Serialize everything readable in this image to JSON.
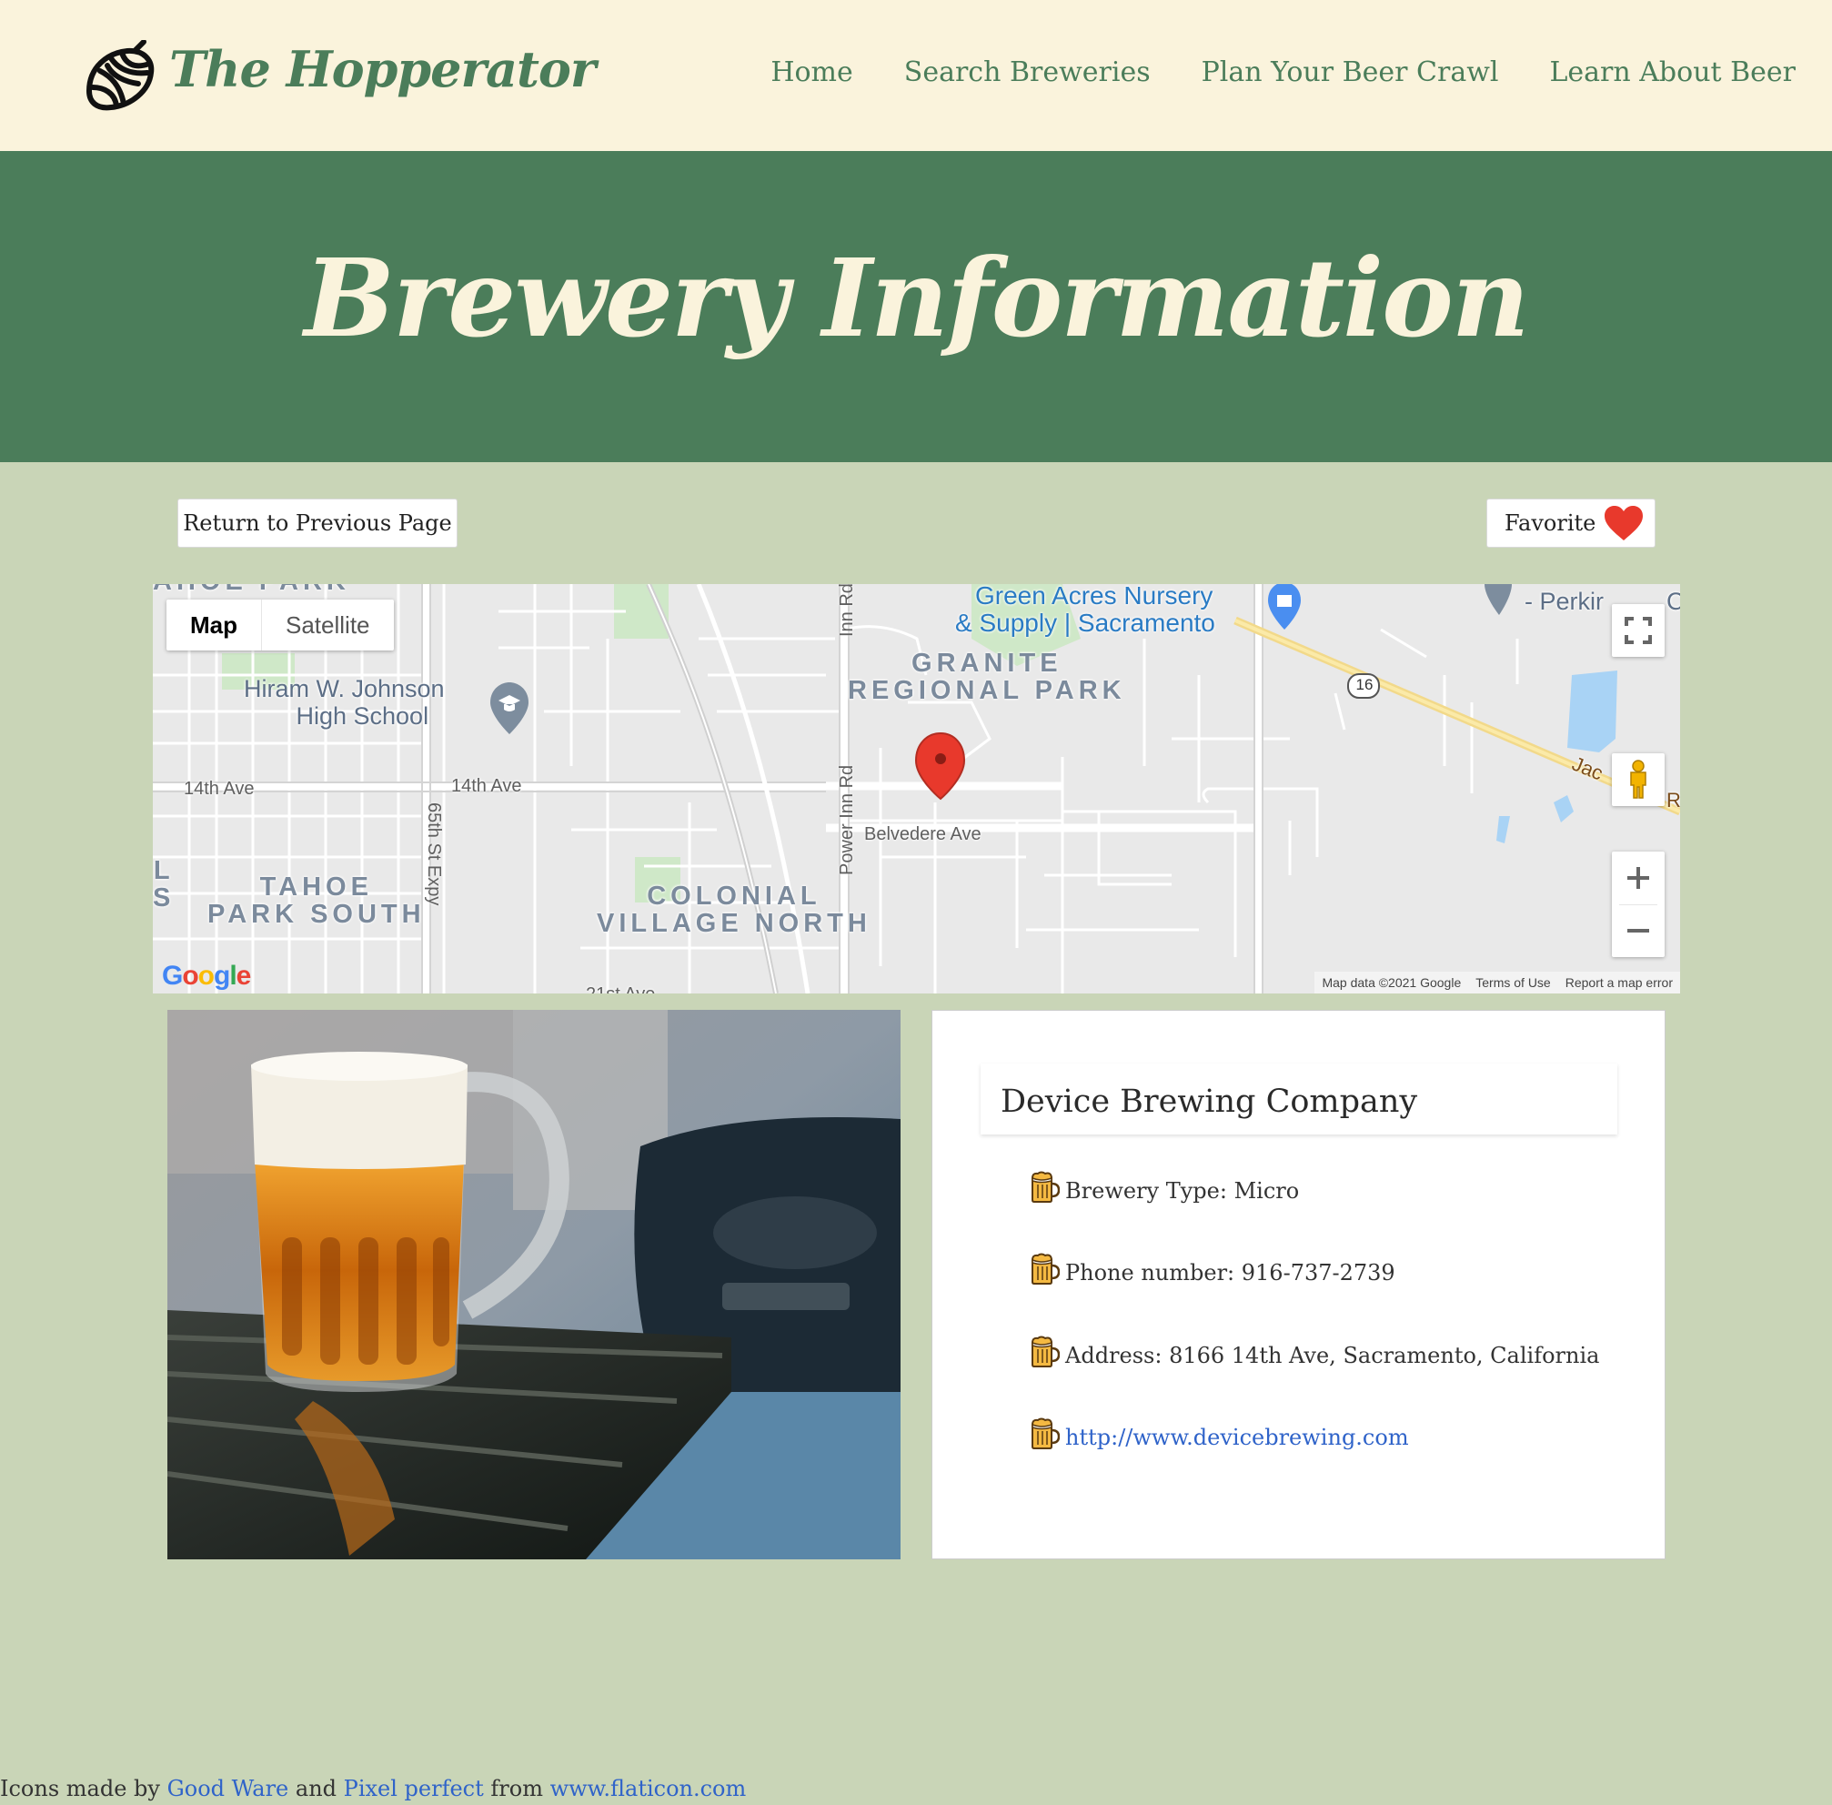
{
  "header": {
    "brand": "The Hopperator",
    "nav": [
      "Home",
      "Search Breweries",
      "Plan Your Beer Crawl",
      "Learn About Beer"
    ]
  },
  "hero": {
    "title": "Brewery Information"
  },
  "actions": {
    "return_label": "Return to Previous Page",
    "favorite_label": "Favorite"
  },
  "map": {
    "type_buttons": [
      "Map",
      "Satellite"
    ],
    "selected_type": "Map",
    "labels": {
      "green_acres": [
        "Green Acres Nursery",
        "& Supply | Sacramento"
      ],
      "granite_park": [
        "GRANITE",
        "REGIONAL PARK"
      ],
      "hiram": [
        "Hiram W. Johnson",
        "High School"
      ],
      "tahoe": [
        "TAHOE",
        "PARK SOUTH"
      ],
      "colonial": [
        "COLONIAL",
        "VILLAGE NORTH"
      ],
      "tahoe_park_top": "AHOE PARK",
      "street_14th_left": "14th Ave",
      "street_14th_mid": "14th Ave",
      "belvedere": "Belvedere Ave",
      "power_inn_top": "Inn Rd",
      "power_inn": "Power Inn Rd",
      "st_65th": "65th St Expy",
      "ave_21st": "21st Ave",
      "route": "16",
      "jackson": "Jac",
      "jackson_2": "R",
      "perkins": [
        "- Perkir",
        "C"
      ],
      "left_edge": [
        "L",
        "S"
      ]
    },
    "attribution": {
      "logo": "Google",
      "data": "Map data ©2021 Google",
      "terms": "Terms of Use",
      "report": "Report a map error"
    }
  },
  "brewery": {
    "name": "Device Brewing Company",
    "type": "Brewery Type: Micro",
    "phone": "Phone number: 916-737-2739",
    "address": "Address: 8166 14th Ave, Sacramento, California",
    "website": "http://www.devicebrewing.com"
  },
  "credits": {
    "prefix": "Icons made by",
    "author1": "Good Ware",
    "and": "and",
    "author2": "Pixel perfect",
    "from": "from",
    "site": "www.flaticon.com"
  },
  "colors": {
    "header_bg": "#faf3dc",
    "brand_green": "#4b7d5a",
    "page_bg": "#c9d5b7",
    "link_blue": "#2f63c9",
    "heart_red": "#e8392c"
  }
}
